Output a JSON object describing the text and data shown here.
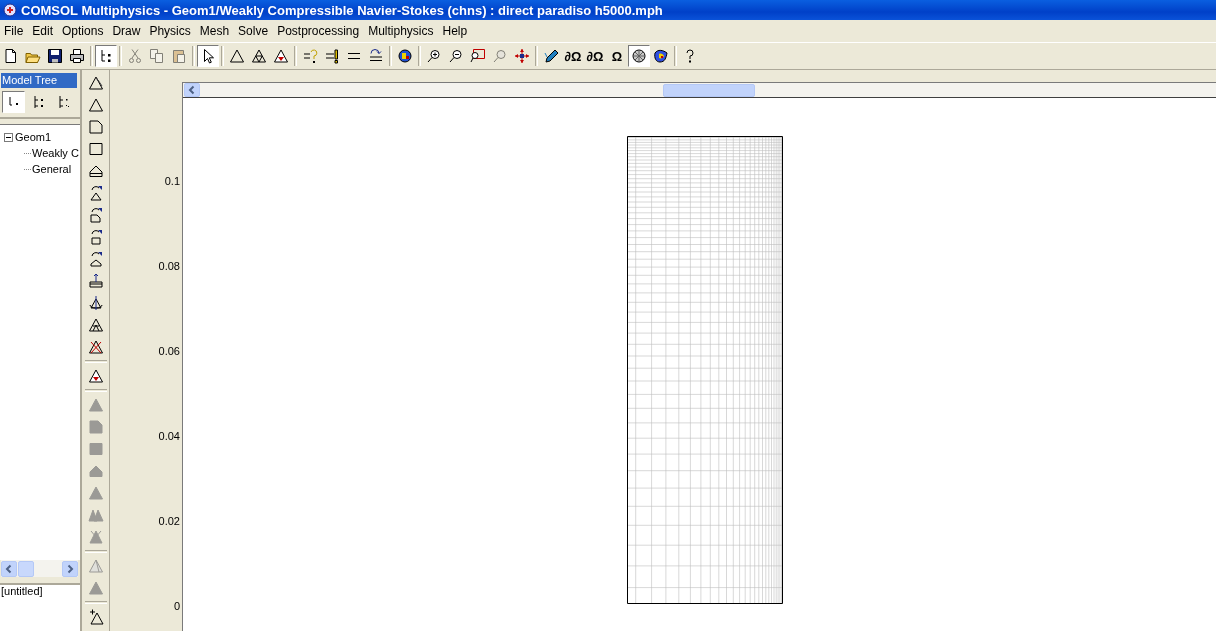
{
  "window": {
    "title": "COMSOL Multiphysics - Geom1/Weakly Compressible Navier-Stokes (chns) : direct paradiso h5000.mph"
  },
  "menu": [
    "File",
    "Edit",
    "Options",
    "Draw",
    "Physics",
    "Mesh",
    "Solve",
    "Postprocessing",
    "Multiphysics",
    "Help"
  ],
  "toolbar": [
    {
      "kind": "new",
      "pressed": false,
      "disabled": false
    },
    {
      "kind": "open",
      "pressed": false,
      "disabled": false
    },
    {
      "kind": "save",
      "pressed": false,
      "disabled": false
    },
    {
      "kind": "print",
      "pressed": false,
      "disabled": false
    },
    {
      "kind": "sep"
    },
    {
      "kind": "tree",
      "pressed": true,
      "disabled": false
    },
    {
      "kind": "sep"
    },
    {
      "kind": "cut",
      "pressed": false,
      "disabled": true
    },
    {
      "kind": "copy",
      "pressed": false,
      "disabled": true
    },
    {
      "kind": "paste",
      "pressed": false,
      "disabled": true
    },
    {
      "kind": "sep"
    },
    {
      "kind": "select",
      "pressed": true,
      "disabled": false
    },
    {
      "kind": "sep"
    },
    {
      "kind": "triangle",
      "pressed": false,
      "disabled": false
    },
    {
      "kind": "triangle-split",
      "pressed": false,
      "disabled": false
    },
    {
      "kind": "triangle-dot",
      "pressed": false,
      "disabled": false
    },
    {
      "kind": "sep"
    },
    {
      "kind": "query",
      "pressed": false,
      "disabled": false
    },
    {
      "kind": "bar",
      "pressed": false,
      "disabled": false
    },
    {
      "kind": "equals",
      "pressed": false,
      "disabled": false
    },
    {
      "kind": "equals-arrow",
      "pressed": false,
      "disabled": false
    },
    {
      "kind": "sep"
    },
    {
      "kind": "globe",
      "pressed": false,
      "disabled": false
    },
    {
      "kind": "sep"
    },
    {
      "kind": "zoom-in",
      "pressed": false,
      "disabled": false
    },
    {
      "kind": "zoom-out",
      "pressed": false,
      "disabled": false
    },
    {
      "kind": "zoom-box",
      "pressed": false,
      "disabled": false
    },
    {
      "kind": "zoom-extents",
      "pressed": false,
      "disabled": true
    },
    {
      "kind": "move",
      "pressed": false,
      "disabled": false
    },
    {
      "kind": "sep"
    },
    {
      "kind": "pencil",
      "pressed": false,
      "disabled": false
    },
    {
      "kind": "symbol",
      "label": "∂Ω",
      "pressed": false,
      "disabled": false
    },
    {
      "kind": "symbol",
      "label": "∂Ω",
      "pressed": false,
      "disabled": false
    },
    {
      "kind": "symbol",
      "label": "Ω",
      "pressed": false,
      "disabled": false
    },
    {
      "kind": "mesh-circle",
      "pressed": true,
      "disabled": false
    },
    {
      "kind": "plot",
      "pressed": false,
      "disabled": false
    },
    {
      "kind": "sep"
    },
    {
      "kind": "help",
      "pressed": false,
      "disabled": false
    }
  ],
  "side_toolbar": [
    {
      "kind": "draw-mode",
      "disabled": false
    },
    {
      "kind": "triangle",
      "disabled": false
    },
    {
      "kind": "polygon",
      "disabled": false
    },
    {
      "kind": "rectangle",
      "disabled": false
    },
    {
      "kind": "layered",
      "disabled": false
    },
    {
      "kind": "rotate-triangle",
      "disabled": false
    },
    {
      "kind": "rotate-polygon",
      "disabled": false
    },
    {
      "kind": "rotate-rectangle",
      "disabled": false
    },
    {
      "kind": "rotate-layered",
      "disabled": false
    },
    {
      "kind": "extrude",
      "disabled": false
    },
    {
      "kind": "revolve",
      "disabled": false
    },
    {
      "kind": "split",
      "disabled": false
    },
    {
      "kind": "delete",
      "disabled": false
    },
    {
      "kind": "sep"
    },
    {
      "kind": "triangle-dot",
      "disabled": false
    },
    {
      "kind": "sep"
    },
    {
      "kind": "triangle",
      "disabled": true
    },
    {
      "kind": "polygon",
      "disabled": true
    },
    {
      "kind": "rectangle",
      "disabled": true
    },
    {
      "kind": "layered",
      "disabled": true
    },
    {
      "kind": "triangle",
      "disabled": true
    },
    {
      "kind": "double",
      "disabled": true
    },
    {
      "kind": "cross",
      "disabled": true
    },
    {
      "kind": "sep"
    },
    {
      "kind": "outline",
      "disabled": true
    },
    {
      "kind": "triangle",
      "disabled": true
    },
    {
      "kind": "sep"
    },
    {
      "kind": "add-point",
      "disabled": false
    }
  ],
  "model_tree": {
    "title": "Model Tree",
    "selected": true,
    "views": [
      {
        "selected": true
      },
      {
        "selected": false
      },
      {
        "selected": false
      }
    ],
    "items": [
      {
        "label": "Geom1",
        "expanded": true,
        "children": [
          {
            "label": "Weakly C"
          },
          {
            "label": "General"
          }
        ]
      }
    ]
  },
  "file_panel": {
    "label": "[untitled]"
  },
  "y_axis": [
    "0.1",
    "0.08",
    "0.06",
    "0.04",
    "0.02",
    "0"
  ]
}
